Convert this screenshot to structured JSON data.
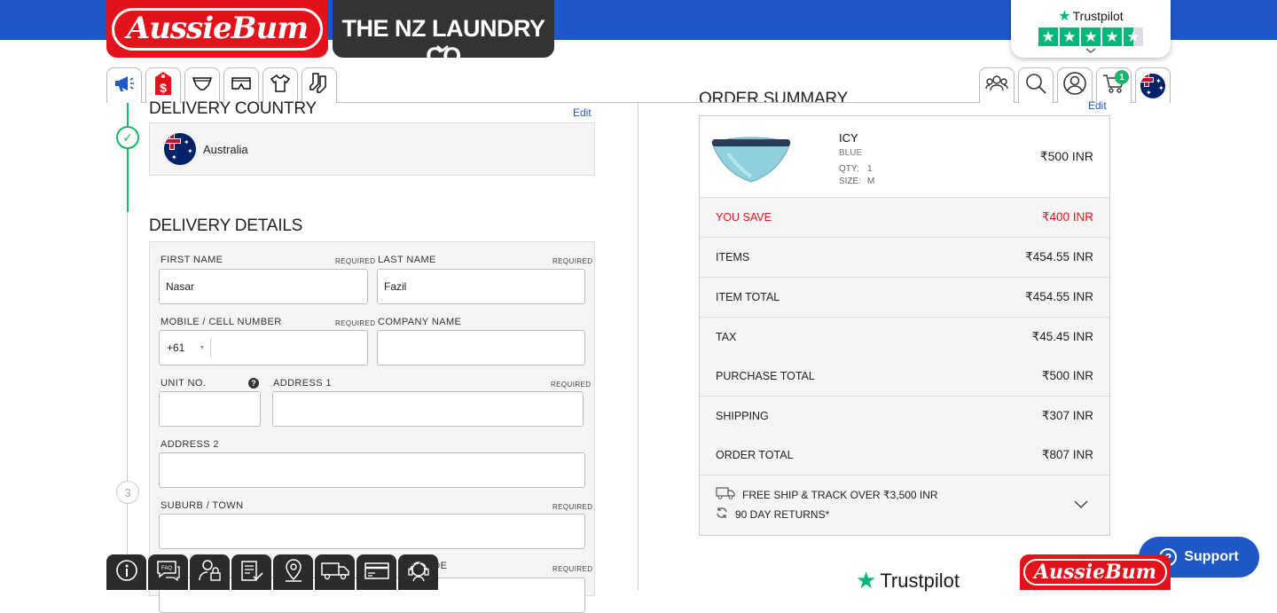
{
  "header": {
    "brand1": "AussieBum",
    "brand2": "THE NZ LAUNDRY CO",
    "trustpilot": "Trustpilot",
    "cart_count": "1"
  },
  "delivery_country": {
    "heading": "DELIVERY COUNTRY",
    "edit": "Edit",
    "country": "Australia"
  },
  "delivery_details": {
    "heading": "DELIVERY DETAILS",
    "step_number": "3",
    "required": "REQUIRED",
    "first_name": {
      "label": "FIRST NAME",
      "value": "Nasar"
    },
    "last_name": {
      "label": "LAST NAME",
      "value": "Fazil"
    },
    "mobile": {
      "label": "MOBILE / CELL NUMBER",
      "country_code": "+61",
      "value": ""
    },
    "company": {
      "label": "COMPANY NAME",
      "value": ""
    },
    "unit": {
      "label": "UNIT NO.",
      "value": ""
    },
    "address1": {
      "label": "ADDRESS 1",
      "value": ""
    },
    "address2": {
      "label": "ADDRESS 2",
      "value": ""
    },
    "suburb": {
      "label": "SUBURB / TOWN",
      "value": ""
    },
    "postcode_partial": "P CODE"
  },
  "order_summary": {
    "heading": "ORDER SUMMARY",
    "edit": "Edit",
    "product": {
      "name": "ICY",
      "color": "BLUE",
      "qty_label": "QTY:",
      "qty": "1",
      "size_label": "SIZE:",
      "size": "M",
      "price": "₹500 INR"
    },
    "rows": [
      {
        "label": "YOU SAVE",
        "amount": "₹400 INR"
      },
      {
        "label": "ITEMS",
        "amount": "₹454.55 INR"
      },
      {
        "label": "ITEM TOTAL",
        "amount": "₹454.55 INR"
      },
      {
        "label": "TAX",
        "amount": "₹45.45 INR"
      },
      {
        "label": "PURCHASE TOTAL",
        "amount": "₹500 INR"
      },
      {
        "label": "SHIPPING",
        "amount": "₹307 INR"
      },
      {
        "label": "ORDER TOTAL",
        "amount": "₹807 INR"
      }
    ],
    "perk_shipping": "FREE SHIP & TRACK OVER ₹3,500 INR",
    "perk_returns": "90 DAY RETURNS*"
  },
  "support": {
    "label": "Support"
  },
  "footer": {
    "trustpilot": "Trustpilot",
    "brand": "AussieBum"
  },
  "colors": {
    "blue": "#1e58c8",
    "red": "#e4131b",
    "green": "#1bb56a",
    "trustpilot_green": "#00b67a"
  }
}
